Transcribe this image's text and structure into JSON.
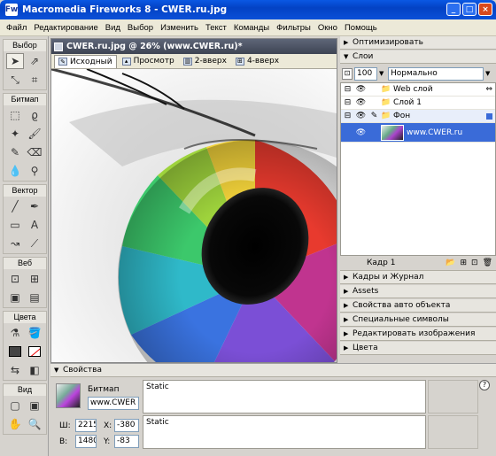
{
  "window": {
    "title": "Macromedia Fireworks 8 - CWER.ru.jpg"
  },
  "menu": [
    "Файл",
    "Редактирование",
    "Вид",
    "Выбор",
    "Изменить",
    "Текст",
    "Команды",
    "Фильтры",
    "Окно",
    "Помощь"
  ],
  "tools": {
    "sections": [
      "Выбор",
      "Битмап",
      "Вектор",
      "Веб",
      "Цвета",
      "Вид"
    ]
  },
  "document": {
    "title": "CWER.ru.jpg @  26% (www.CWER.ru)*",
    "tabs": [
      "Исходный",
      "Просмотр",
      "2-вверх",
      "4-вверх"
    ],
    "active_tab": "Исходный"
  },
  "panels": {
    "optimize": "Оптимизировать",
    "layers": "Слои",
    "opacity": "100",
    "blend_mode": "Нормально",
    "layer_items": [
      {
        "name": "Web слой",
        "kind": "folder"
      },
      {
        "name": "Слой 1",
        "kind": "folder"
      },
      {
        "name": "Фон",
        "kind": "folder"
      },
      {
        "name": "www.CWER.ru",
        "kind": "bitmap"
      }
    ],
    "frame_label": "Кадр 1",
    "collapsed": [
      "Кадры и Журнал",
      "Assets",
      "Свойства авто объекта",
      "Специальные символы",
      "Редактировать изображения",
      "Цвета"
    ]
  },
  "properties": {
    "title": "Свойства",
    "kind": "Битмап",
    "name": "www.CWER",
    "w_label": "Ш:",
    "w": "2215",
    "h_label": "В:",
    "h": "1480",
    "x_label": "X:",
    "x": "-380",
    "y_label": "Y:",
    "y": "-83",
    "static1": "Static",
    "static2": "Static",
    "help": "?"
  }
}
